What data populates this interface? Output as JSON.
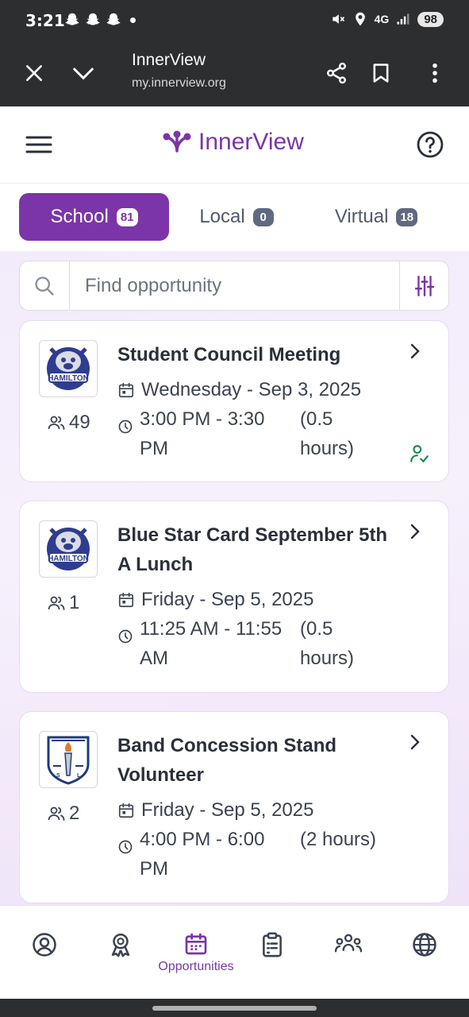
{
  "status_bar": {
    "time": "3:21",
    "network": "4G",
    "battery": "98"
  },
  "browser": {
    "title": "InnerView",
    "url": "my.innerview.org"
  },
  "app": {
    "name": "InnerView",
    "brand_color": "#7b35a8"
  },
  "tabs": [
    {
      "label": "School",
      "count": "81",
      "active": true
    },
    {
      "label": "Local",
      "count": "0",
      "active": false
    },
    {
      "label": "Virtual",
      "count": "18",
      "active": false
    }
  ],
  "search": {
    "placeholder": "Find opportunity"
  },
  "opportunities": [
    {
      "title": "Student Council Meeting",
      "participants": "49",
      "date": "Wednesday - Sep 3, 2025",
      "time": "3:00 PM - 3:30 PM",
      "duration": "(0.5 hours)",
      "logo": "hamilton-bulldog-logo",
      "checked_in": true
    },
    {
      "title": "Blue Star Card September 5th A Lunch",
      "participants": "1",
      "date": "Friday - Sep 5, 2025",
      "time": "11:25 AM - 11:55 AM",
      "duration": "(0.5 hours)",
      "logo": "hamilton-bulldog-logo",
      "checked_in": false
    },
    {
      "title": "Band Concession Stand Volunteer",
      "participants": "2",
      "date": "Friday - Sep 5, 2025",
      "time": "4:00 PM - 6:00 PM",
      "duration": "(2 hours)",
      "logo": "national-honor-society-logo",
      "checked_in": false
    }
  ],
  "bottom_nav": {
    "items": [
      {
        "icon": "profile-icon",
        "label": ""
      },
      {
        "icon": "award-icon",
        "label": ""
      },
      {
        "icon": "calendar-icon",
        "label": "Opportunities",
        "active": true
      },
      {
        "icon": "clipboard-icon",
        "label": ""
      },
      {
        "icon": "group-icon",
        "label": ""
      },
      {
        "icon": "globe-icon",
        "label": ""
      }
    ]
  }
}
